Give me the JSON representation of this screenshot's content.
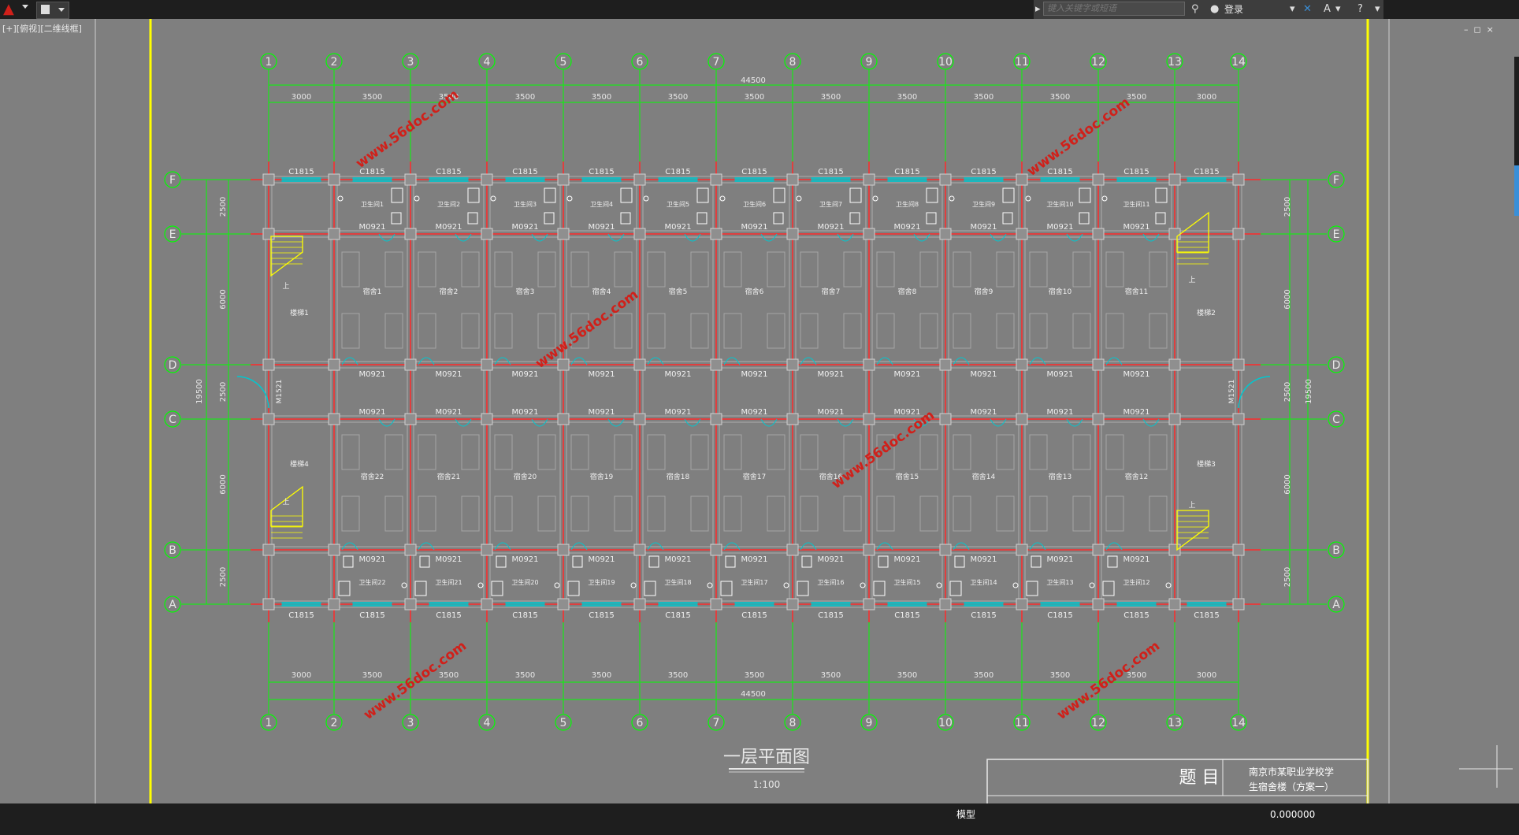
{
  "toolbar": {
    "search_placeholder": "键入关键字或短语",
    "login_label": "登录",
    "help_icon": "help-icon",
    "colors": {
      "bar": "#1e1e1e",
      "brand_red": "#d0201a"
    }
  },
  "viewport": {
    "label": "[+][俯视][二维线框]",
    "colors": {
      "background": "#7f7f7f",
      "grid": "#00ff00",
      "axis": "#ff2a2a",
      "window": "#00c8d0",
      "frame": "#ffff00"
    }
  },
  "drawing": {
    "column_axes_top": [
      "1",
      "2",
      "3",
      "4",
      "5",
      "6",
      "7",
      "8",
      "9",
      "10",
      "11",
      "12",
      "13",
      "14"
    ],
    "column_axes_bottom": [
      "1",
      "2",
      "3",
      "4",
      "5",
      "6",
      "7",
      "8",
      "9",
      "10",
      "11",
      "12",
      "13",
      "14"
    ],
    "row_axes": [
      "F",
      "E",
      "D",
      "C",
      "B",
      "A"
    ],
    "overall_dimension": "44500",
    "span_dimensions_top": [
      "3000",
      "3500",
      "3500",
      "3500",
      "3500",
      "3500",
      "3500",
      "3500",
      "3500",
      "3500",
      "3500",
      "3500",
      "3000"
    ],
    "span_dimensions_bottom": [
      "3000",
      "3500",
      "3500",
      "3500",
      "3500",
      "3500",
      "3500",
      "3500",
      "3500",
      "3500",
      "3500",
      "3500",
      "3000"
    ],
    "vertical_dims": [
      "2500",
      "6000",
      "2500",
      "6000",
      "2500"
    ],
    "total_depth": "19500",
    "window_label": "C1815",
    "door_label": "M0921",
    "entry_door_label": "M1521",
    "stair_up": "上",
    "stairs": [
      "楼梯1",
      "楼梯2",
      "楼梯3",
      "楼梯4"
    ],
    "toilets_top": [
      "卫生间1",
      "卫生间2",
      "卫生间3",
      "卫生间4",
      "卫生间5",
      "卫生间6",
      "卫生间7",
      "卫生间8",
      "卫生间9",
      "卫生间10",
      "卫生间11"
    ],
    "dorms_top": [
      "宿舍1",
      "宿舍2",
      "宿舍3",
      "宿舍4",
      "宿舍5",
      "宿舍6",
      "宿舍7",
      "宿舍8",
      "宿舍9",
      "宿舍10",
      "宿舍11"
    ],
    "dorms_bottom": [
      "宿舍22",
      "宿舍21",
      "宿舍20",
      "宿舍19",
      "宿舍18",
      "宿舍17",
      "宿舍16",
      "宿舍15",
      "宿舍14",
      "宿舍13",
      "宿舍12"
    ],
    "toilets_bottom": [
      "卫生间22",
      "卫生间21",
      "卫生间20",
      "卫生间19",
      "卫生间18",
      "卫生间17",
      "卫生间16",
      "卫生间15",
      "卫生间14",
      "卫生间13",
      "卫生间12"
    ],
    "watermark": "www.56doc.com",
    "plan_title": "一层平面图",
    "plan_scale": "1:100"
  },
  "title_block": {
    "label": "题 目",
    "line1": "南京市某职业学校学",
    "line2": "生宿舍楼（方案一）"
  },
  "statusbar": {
    "model_label": "模型",
    "coordinate": "0.000000"
  }
}
